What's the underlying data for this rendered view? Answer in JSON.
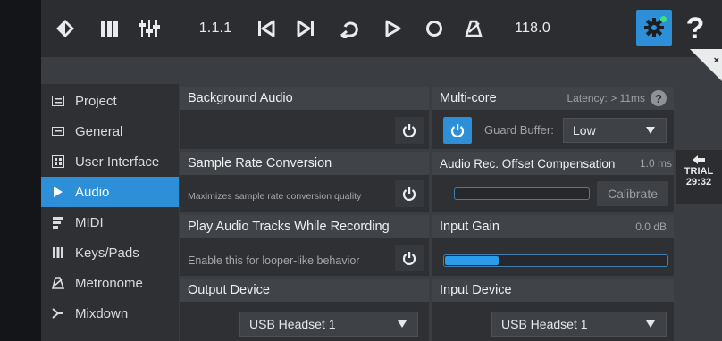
{
  "toolbar": {
    "position": "1.1.1",
    "tempo": "118.0",
    "help": "?"
  },
  "close": {
    "label": "×"
  },
  "sidebar": {
    "items": [
      {
        "label": "Project",
        "icon": "project-icon"
      },
      {
        "label": "General",
        "icon": "general-icon"
      },
      {
        "label": "User Interface",
        "icon": "user-interface-icon"
      },
      {
        "label": "Audio",
        "icon": "play-icon",
        "active": true
      },
      {
        "label": "MIDI",
        "icon": "midi-icon"
      },
      {
        "label": "Keys/Pads",
        "icon": "keys-icon"
      },
      {
        "label": "Metronome",
        "icon": "metronome-icon"
      },
      {
        "label": "Mixdown",
        "icon": "mixdown-icon"
      }
    ]
  },
  "panels": {
    "background_audio": {
      "title": "Background Audio"
    },
    "sample_rate": {
      "title": "Sample Rate Conversion",
      "desc": "Maximizes sample rate conversion quality"
    },
    "play_audio": {
      "title": "Play Audio Tracks While Recording",
      "desc": "Enable this for looper-like behavior"
    },
    "output_device": {
      "title": "Output Device",
      "value": "USB Headset 1"
    },
    "multicore": {
      "title": "Multi-core",
      "latency": "Latency: > 11ms",
      "guard_label": "Guard Buffer:",
      "guard_value": "Low"
    },
    "offset": {
      "title": "Audio Rec. Offset Compensation",
      "value": "1.0 ms",
      "button": "Calibrate",
      "level": 0.0
    },
    "input_gain": {
      "title": "Input Gain",
      "value": "0.0 dB",
      "level": 0.24
    },
    "input_device": {
      "title": "Input Device",
      "value": "USB Headset 1"
    }
  },
  "trial": {
    "label": "TRIAL",
    "time": "29:32"
  },
  "colors": {
    "accent": "#2c8fd8",
    "panel": "#2e3034",
    "header": "#404348"
  }
}
